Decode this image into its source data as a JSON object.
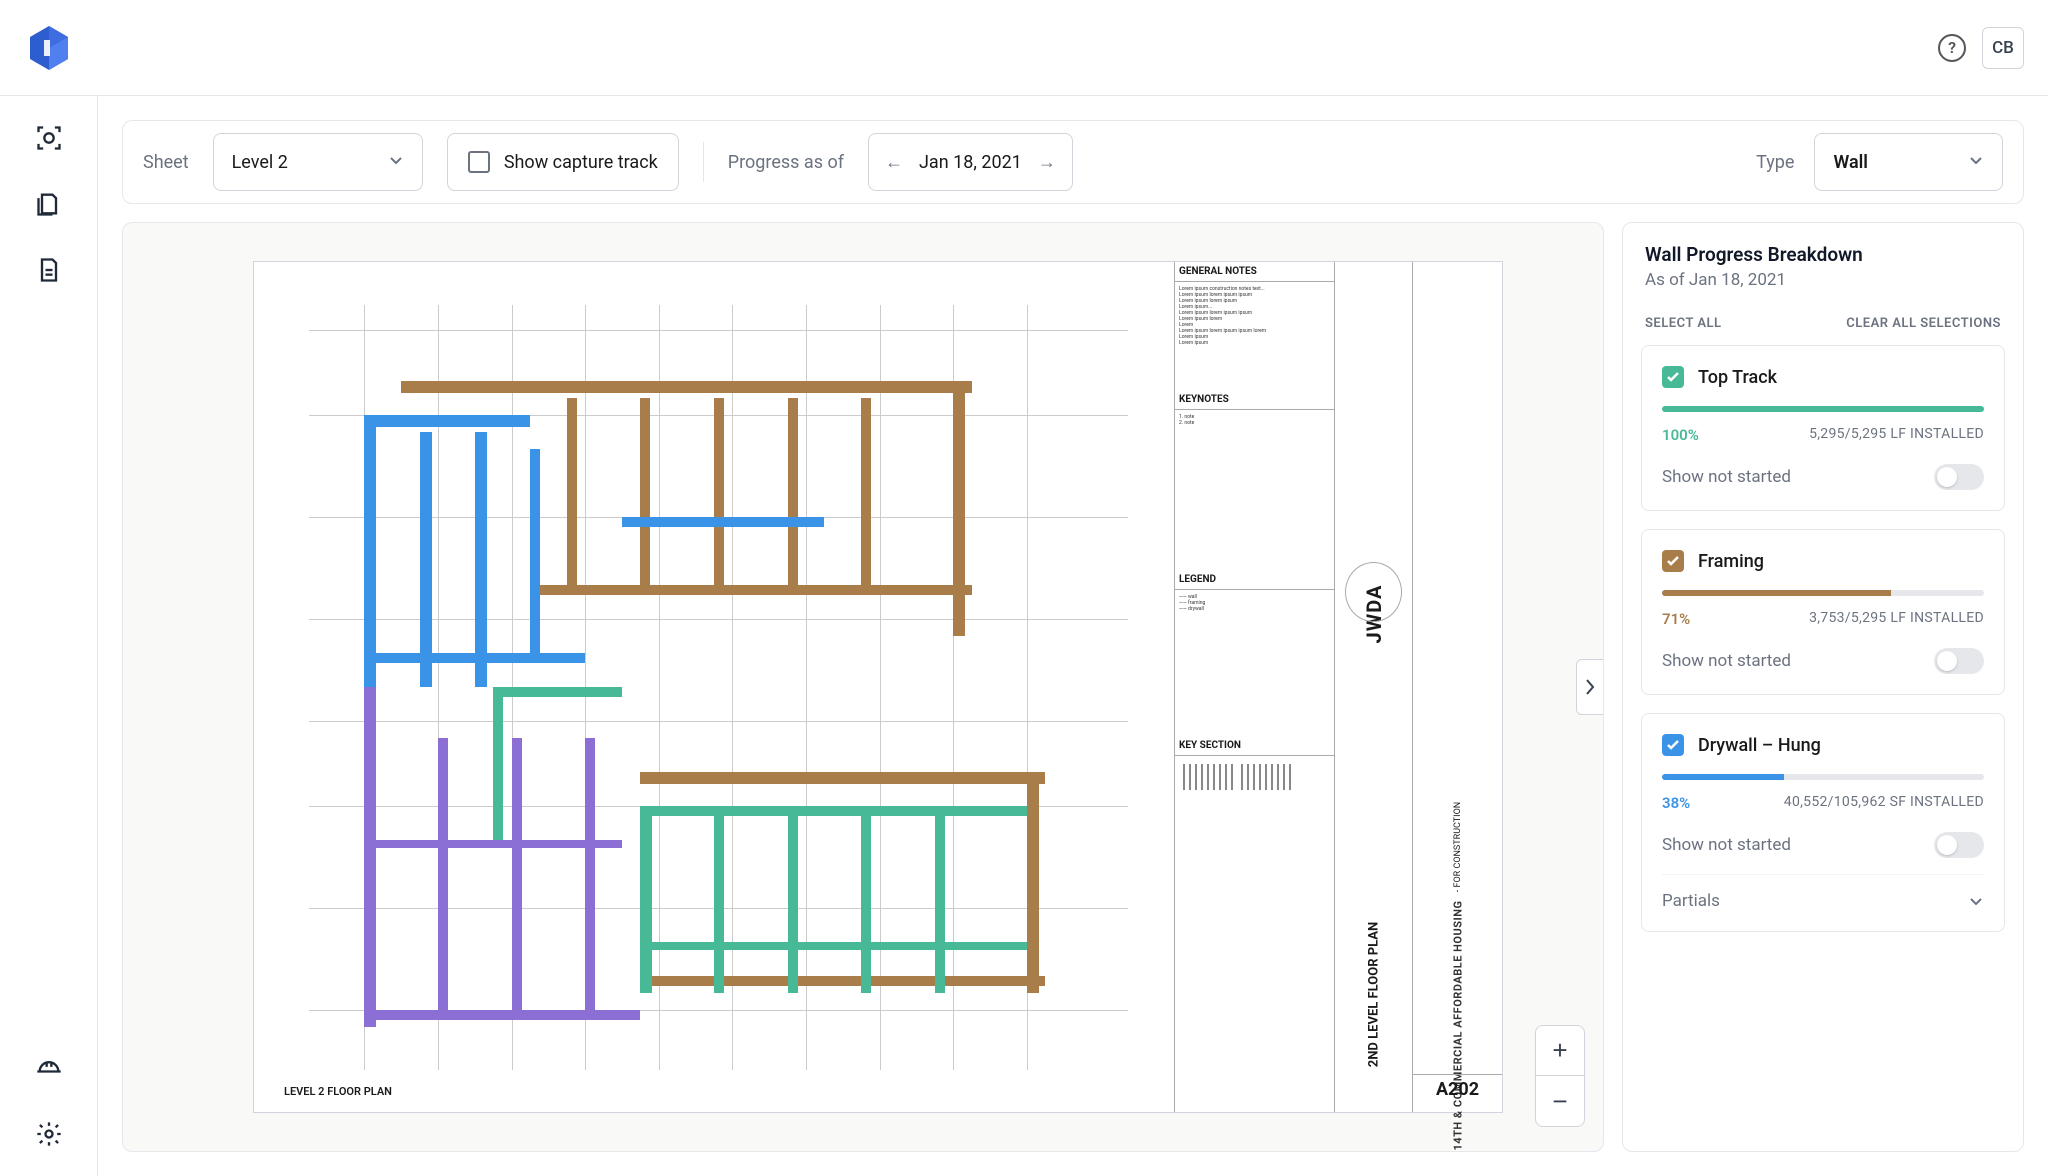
{
  "topbar": {
    "avatar": "CB"
  },
  "toolbar": {
    "sheet_label": "Sheet",
    "sheet_value": "Level 2",
    "capture_label": "Show capture track",
    "progress_label": "Progress as of",
    "date_value": "Jan 18, 2021",
    "type_label": "Type",
    "type_value": "Wall"
  },
  "plan": {
    "general_notes": "GENERAL NOTES",
    "keynotes": "KEYNOTES",
    "legend": "LEGEND",
    "key_section": "KEY SECTION",
    "jwda": "JWDA",
    "plan_name": "2ND LEVEL FLOOR PLAN",
    "sheet_number": "A202",
    "project_title": "14TH & COMMERCIAL AFFORDABLE HOUSING",
    "permit": "- FOR CONSTRUCTION",
    "floor_label": "LEVEL 2 FLOOR PLAN"
  },
  "panel": {
    "title": "Wall Progress Breakdown",
    "subtitle": "As of Jan 18, 2021",
    "select_all": "SELECT ALL",
    "clear_all": "CLEAR ALL SELECTIONS",
    "show_not_started": "Show not started",
    "partials": "Partials",
    "cards": [
      {
        "name": "Top Track",
        "color": "#47b997",
        "pct": "100%",
        "installed": "5,295/5,295 LF INSTALLED",
        "fill": 100
      },
      {
        "name": "Framing",
        "color": "#a87d4a",
        "pct": "71%",
        "installed": "3,753/5,295 LF INSTALLED",
        "fill": 71
      },
      {
        "name": "Drywall – Hung",
        "color": "#3b93e8",
        "pct": "38%",
        "installed": "40,552/105,962 SF INSTALLED",
        "fill": 38
      }
    ]
  }
}
